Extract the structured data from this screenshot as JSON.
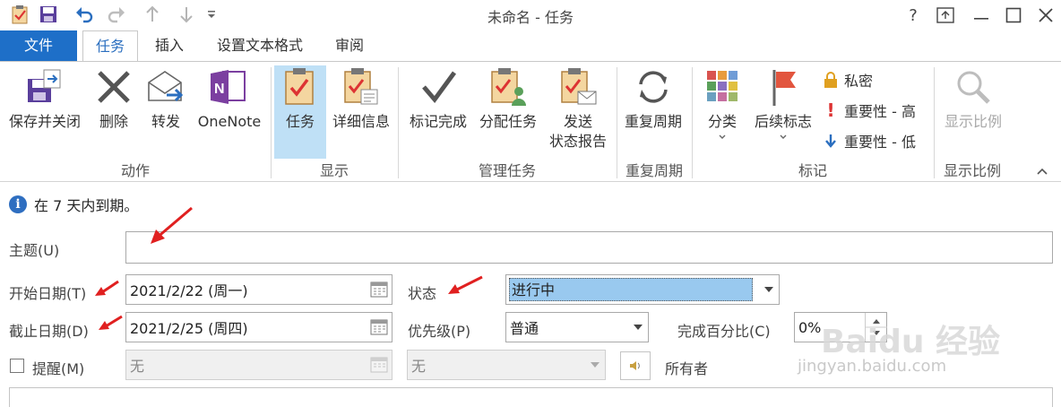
{
  "window": {
    "title": "未命名 - 任务",
    "help": "?"
  },
  "tabs": {
    "file": "文件",
    "task": "任务",
    "insert": "插入",
    "format_text": "设置文本格式",
    "review": "审阅"
  },
  "ribbon": {
    "save_close": "保存并关闭",
    "delete": "删除",
    "forward": "转发",
    "onenote": "OneNote",
    "group_actions": "动作",
    "task_view": "任务",
    "details": "详细信息",
    "group_show": "显示",
    "mark_complete": "标记完成",
    "assign_task": "分配任务",
    "send_status_1": "发送",
    "send_status_2": "状态报告",
    "group_manage": "管理任务",
    "recurrence": "重复周期",
    "group_recurrence": "重复周期",
    "categorize": "分类",
    "follow_up": "后续标志",
    "private": "私密",
    "importance_high": "重要性 - 高",
    "importance_low": "重要性 - 低",
    "group_tags": "标记",
    "zoom": "显示比例",
    "group_zoom": "显示比例"
  },
  "form": {
    "info_text": "在 7 天内到期。",
    "subject_label": "主题(U)",
    "subject_value": "",
    "start_label": "开始日期(T)",
    "start_value": "2021/2/22 (周一)",
    "due_label": "截止日期(D)",
    "due_value": "2021/2/25 (周四)",
    "status_label": "状态",
    "status_value": "进行中",
    "priority_label": "优先级(P)",
    "priority_value": "普通",
    "percent_label": "完成百分比(C)",
    "percent_value": "0%",
    "reminder_label": "提醒(M)",
    "reminder_date": "无",
    "reminder_time": "无",
    "owner_label": "所有者"
  },
  "watermark": {
    "brand": "Baidu 经验",
    "url": "jingyan.baidu.com"
  },
  "colors": {
    "accent": "#1e6fc8",
    "selected": "#bfe0f6",
    "status_highlight": "#99c9ef",
    "arrow": "#e02020"
  }
}
